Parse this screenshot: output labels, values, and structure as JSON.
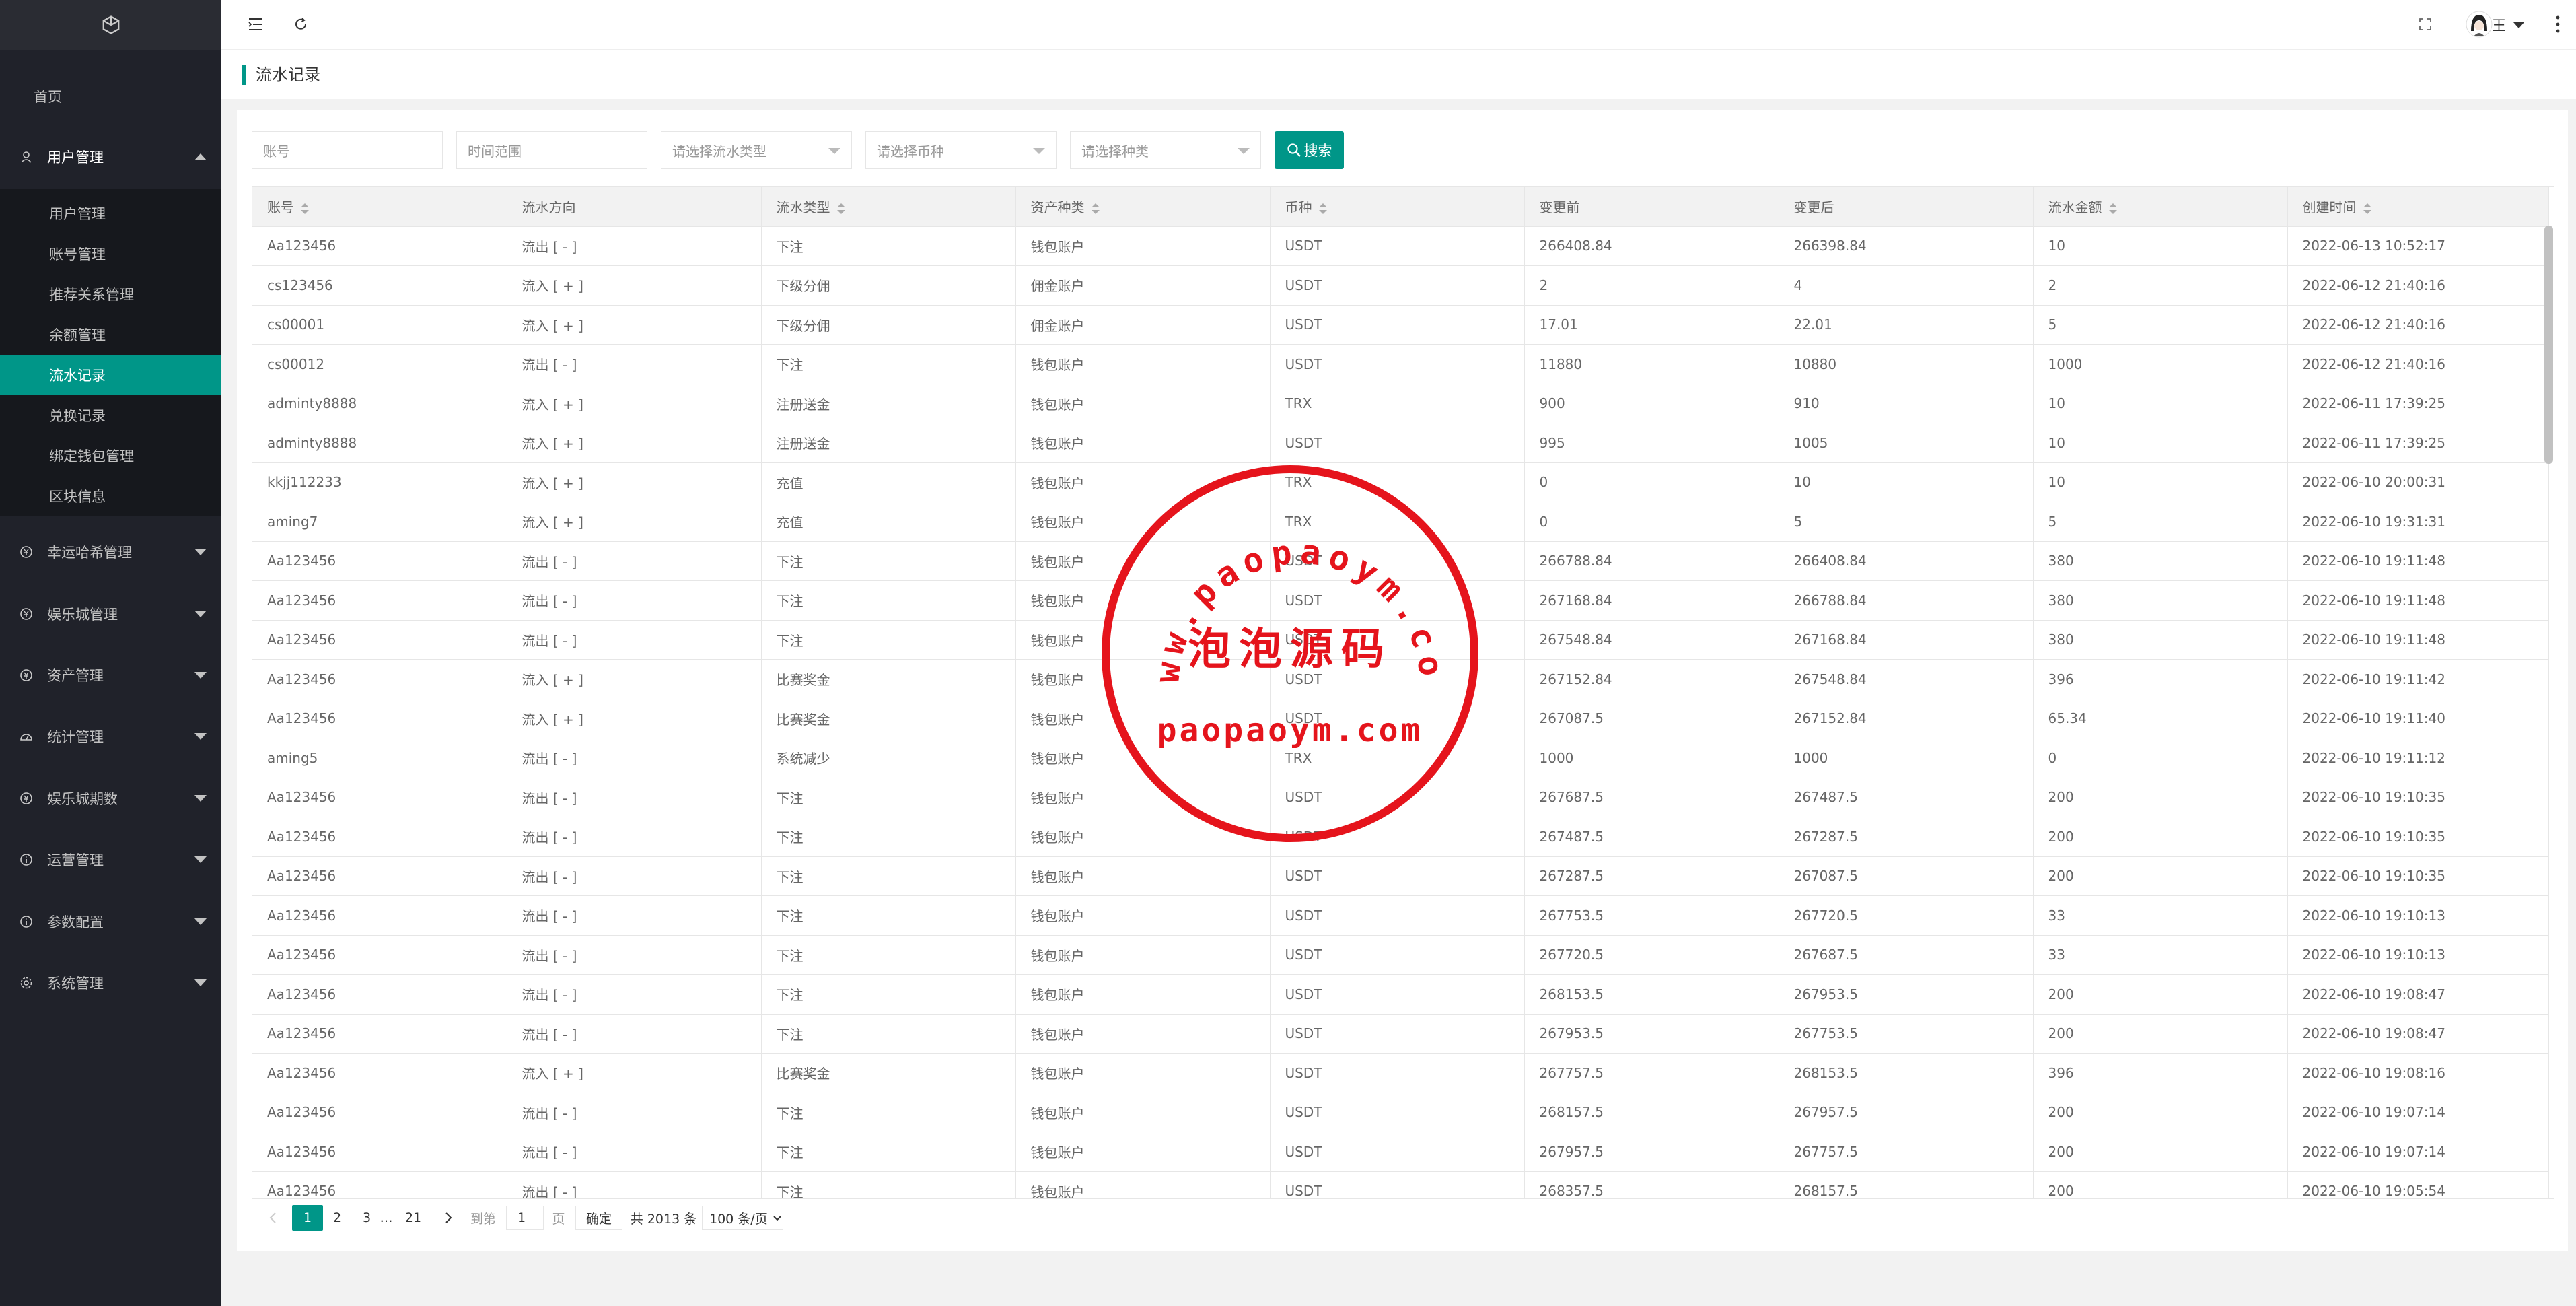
{
  "sidebar": {
    "home": "首页",
    "groups": [
      {
        "label": "用户管理",
        "icon": "user-icon"
      },
      {
        "label": "幸运哈希管理",
        "icon": "coin-icon"
      },
      {
        "label": "娱乐城管理",
        "icon": "coin-icon"
      },
      {
        "label": "资产管理",
        "icon": "coin-icon"
      },
      {
        "label": "统计管理",
        "icon": "gauge-icon"
      },
      {
        "label": "娱乐城期数",
        "icon": "coin-icon"
      },
      {
        "label": "运营管理",
        "icon": "info-icon"
      },
      {
        "label": "参数配置",
        "icon": "info-icon"
      },
      {
        "label": "系统管理",
        "icon": "gear-icon"
      }
    ],
    "sub_items": [
      "用户管理",
      "账号管理",
      "推荐关系管理",
      "余额管理",
      "流水记录",
      "兑换记录",
      "绑定钱包管理",
      "区块信息"
    ],
    "active_sub": "流水记录"
  },
  "header": {
    "user_name": "王",
    "accent": "#009688"
  },
  "page": {
    "tab_title": "流水记录"
  },
  "filters": {
    "account_placeholder": "账号",
    "time_placeholder": "时间范围",
    "flow_type_placeholder": "请选择流水类型",
    "currency_placeholder": "请选择币种",
    "kind_placeholder": "请选择种类",
    "search_label": "搜索"
  },
  "table": {
    "columns": [
      "账号",
      "流水方向",
      "流水类型",
      "资产种类",
      "币种",
      "变更前",
      "变更后",
      "流水金额",
      "创建时间"
    ],
    "rows": [
      [
        "Aa123456",
        "流出 [ - ]",
        "下注",
        "钱包账户",
        "USDT",
        "266408.84",
        "266398.84",
        "10",
        "2022-06-13 10:52:17"
      ],
      [
        "cs123456",
        "流入 [ + ]",
        "下级分佣",
        "佣金账户",
        "USDT",
        "2",
        "4",
        "2",
        "2022-06-12 21:40:16"
      ],
      [
        "cs00001",
        "流入 [ + ]",
        "下级分佣",
        "佣金账户",
        "USDT",
        "17.01",
        "22.01",
        "5",
        "2022-06-12 21:40:16"
      ],
      [
        "cs00012",
        "流出 [ - ]",
        "下注",
        "钱包账户",
        "USDT",
        "11880",
        "10880",
        "1000",
        "2022-06-12 21:40:16"
      ],
      [
        "adminty8888",
        "流入 [ + ]",
        "注册送金",
        "钱包账户",
        "TRX",
        "900",
        "910",
        "10",
        "2022-06-11 17:39:25"
      ],
      [
        "adminty8888",
        "流入 [ + ]",
        "注册送金",
        "钱包账户",
        "USDT",
        "995",
        "1005",
        "10",
        "2022-06-11 17:39:25"
      ],
      [
        "kkjj112233",
        "流入 [ + ]",
        "充值",
        "钱包账户",
        "TRX",
        "0",
        "10",
        "10",
        "2022-06-10 20:00:31"
      ],
      [
        "aming7",
        "流入 [ + ]",
        "充值",
        "钱包账户",
        "TRX",
        "0",
        "5",
        "5",
        "2022-06-10 19:31:31"
      ],
      [
        "Aa123456",
        "流出 [ - ]",
        "下注",
        "钱包账户",
        "USDT",
        "266788.84",
        "266408.84",
        "380",
        "2022-06-10 19:11:48"
      ],
      [
        "Aa123456",
        "流出 [ - ]",
        "下注",
        "钱包账户",
        "USDT",
        "267168.84",
        "266788.84",
        "380",
        "2022-06-10 19:11:48"
      ],
      [
        "Aa123456",
        "流出 [ - ]",
        "下注",
        "钱包账户",
        "USDT",
        "267548.84",
        "267168.84",
        "380",
        "2022-06-10 19:11:48"
      ],
      [
        "Aa123456",
        "流入 [ + ]",
        "比赛奖金",
        "钱包账户",
        "USDT",
        "267152.84",
        "267548.84",
        "396",
        "2022-06-10 19:11:42"
      ],
      [
        "Aa123456",
        "流入 [ + ]",
        "比赛奖金",
        "钱包账户",
        "USDT",
        "267087.5",
        "267152.84",
        "65.34",
        "2022-06-10 19:11:40"
      ],
      [
        "aming5",
        "流出 [ - ]",
        "系统减少",
        "钱包账户",
        "TRX",
        "1000",
        "1000",
        "0",
        "2022-06-10 19:11:12"
      ],
      [
        "Aa123456",
        "流出 [ - ]",
        "下注",
        "钱包账户",
        "USDT",
        "267687.5",
        "267487.5",
        "200",
        "2022-06-10 19:10:35"
      ],
      [
        "Aa123456",
        "流出 [ - ]",
        "下注",
        "钱包账户",
        "USDT",
        "267487.5",
        "267287.5",
        "200",
        "2022-06-10 19:10:35"
      ],
      [
        "Aa123456",
        "流出 [ - ]",
        "下注",
        "钱包账户",
        "USDT",
        "267287.5",
        "267087.5",
        "200",
        "2022-06-10 19:10:35"
      ],
      [
        "Aa123456",
        "流出 [ - ]",
        "下注",
        "钱包账户",
        "USDT",
        "267753.5",
        "267720.5",
        "33",
        "2022-06-10 19:10:13"
      ],
      [
        "Aa123456",
        "流出 [ - ]",
        "下注",
        "钱包账户",
        "USDT",
        "267720.5",
        "267687.5",
        "33",
        "2022-06-10 19:10:13"
      ],
      [
        "Aa123456",
        "流出 [ - ]",
        "下注",
        "钱包账户",
        "USDT",
        "268153.5",
        "267953.5",
        "200",
        "2022-06-10 19:08:47"
      ],
      [
        "Aa123456",
        "流出 [ - ]",
        "下注",
        "钱包账户",
        "USDT",
        "267953.5",
        "267753.5",
        "200",
        "2022-06-10 19:08:47"
      ],
      [
        "Aa123456",
        "流入 [ + ]",
        "比赛奖金",
        "钱包账户",
        "USDT",
        "267757.5",
        "268153.5",
        "396",
        "2022-06-10 19:08:16"
      ],
      [
        "Aa123456",
        "流出 [ - ]",
        "下注",
        "钱包账户",
        "USDT",
        "268157.5",
        "267957.5",
        "200",
        "2022-06-10 19:07:14"
      ],
      [
        "Aa123456",
        "流出 [ - ]",
        "下注",
        "钱包账户",
        "USDT",
        "267957.5",
        "267757.5",
        "200",
        "2022-06-10 19:07:14"
      ],
      [
        "Aa123456",
        "流出 [ - ]",
        "下注",
        "钱包账户",
        "USDT",
        "268357.5",
        "268157.5",
        "200",
        "2022-06-10 19:05:54"
      ]
    ]
  },
  "pagination": {
    "pages": [
      "1",
      "2",
      "3",
      "…",
      "21"
    ],
    "current": "1",
    "goto_prefix": "到第",
    "goto_value": "1",
    "goto_suffix": "页",
    "confirm": "确定",
    "total": "共 2013 条",
    "page_size": "100 条/页"
  },
  "watermark": {
    "ring_text": "www.paopaoym.com",
    "center_text": "泡泡源码",
    "bottom_text": "paopaoym.com"
  }
}
